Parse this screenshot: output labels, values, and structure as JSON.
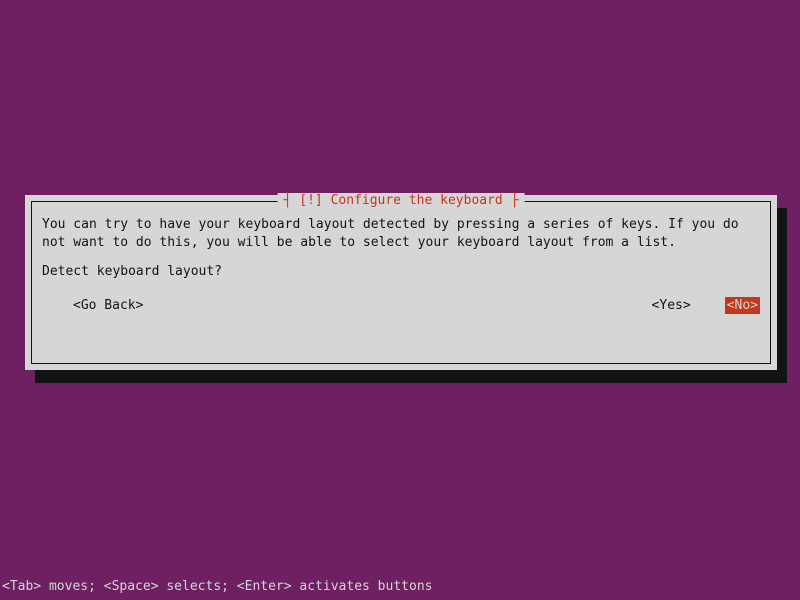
{
  "dialog": {
    "title_open": "┤",
    "title_exclaim": " [!] ",
    "title_text": "Configure the keyboard ",
    "title_close": "├",
    "body_text": "You can try to have your keyboard layout detected by pressing a series of keys. If you do not want to do this, you will be able to select your keyboard layout from a list.",
    "question": "Detect keyboard layout?",
    "buttons": {
      "go_back": "<Go Back>",
      "yes": "<Yes>",
      "no": "<No>"
    }
  },
  "status_bar": "<Tab> moves; <Space> selects; <Enter> activates buttons"
}
